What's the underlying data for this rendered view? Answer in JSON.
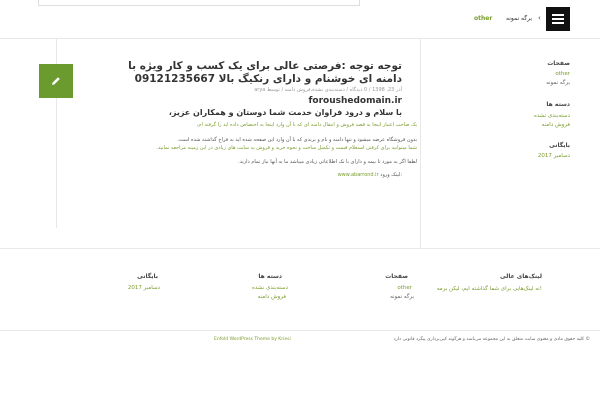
{
  "header": {
    "nav": {
      "other": "other",
      "sample_page": "برگه نمونه"
    }
  },
  "post": {
    "title": "توجه توجه :فرصتی عالی برای یک کسب و کار ویژه با دامنه ای خوشنام و دارای رنکیگ بالا 09121235667",
    "meta": "آذر 23, 1398 / 0 دیدگاه / دسته‌بندی نشده,فروش دامنه / توسط arya",
    "domain": "foroushedomain.ir",
    "greeting": "با سلام و درود فراوان خدمت شما دوستان و همکاران عزیز،",
    "p1": "یک صاحب اعتبار اینجا به قصد فروش و انتقال دامنه ای که با آن وارد اینجا به اختصاص داده اید را گرفته ام،",
    "p2": "بدون فروشگاه عرضه میشود و تنها دامنه و نام و برندی که با آن وارد این صفحه شده اید به فراخ گذاشته شده است.",
    "p3": "شما میتوانید برای کرفتن استعلام قیمت و تکمیل ساخت و نحوه خرید و فروش به سایت های زیادی در این زمینه مراجعه نمایید.",
    "p4": "لطفا اگر به مورد تا بیمه و دارای با نک اطلاعاتی زیادی میباشد ما به آنها نیاز تمام دارند.",
    "site_label": "لینک ورود:",
    "site_url": "www.abarrond.ir"
  },
  "sidebar": {
    "pages_title": "صفحات",
    "pages": [
      "other",
      "برگه نمونه"
    ],
    "categories_title": "دسته ها",
    "categories": [
      "دسته‌بندی نشده",
      "فروش دامنه"
    ],
    "archives_title": "بایگانی",
    "archives": [
      "دسامبر 2017"
    ]
  },
  "footer_widgets": {
    "links_title": "لینک‌های عالی",
    "links_text": "نه لینک‌هایی برای شما گذاشته ایم، لیکن برمه!",
    "pages_title": "صفحات",
    "pages": [
      "other",
      "برگه نمونه"
    ],
    "categories_title": "دسته ها",
    "categories": [
      "دسته‌بندی نشده",
      "فروش دامنه"
    ],
    "archives_title": "بایگانی",
    "archives": [
      "دسامبر 2017"
    ]
  },
  "footer": {
    "credit": "Enfold WordPress Theme by Kriesi",
    "copyright": "© کلیه حقوق مادی و معنوی سایت متعلق به این مجموعه می‌باشد و هرگونه کپی‌برداری پیگرد قانونی دارد"
  },
  "colors": {
    "accent": "#6b9a2f",
    "link": "#7a9c2e"
  }
}
